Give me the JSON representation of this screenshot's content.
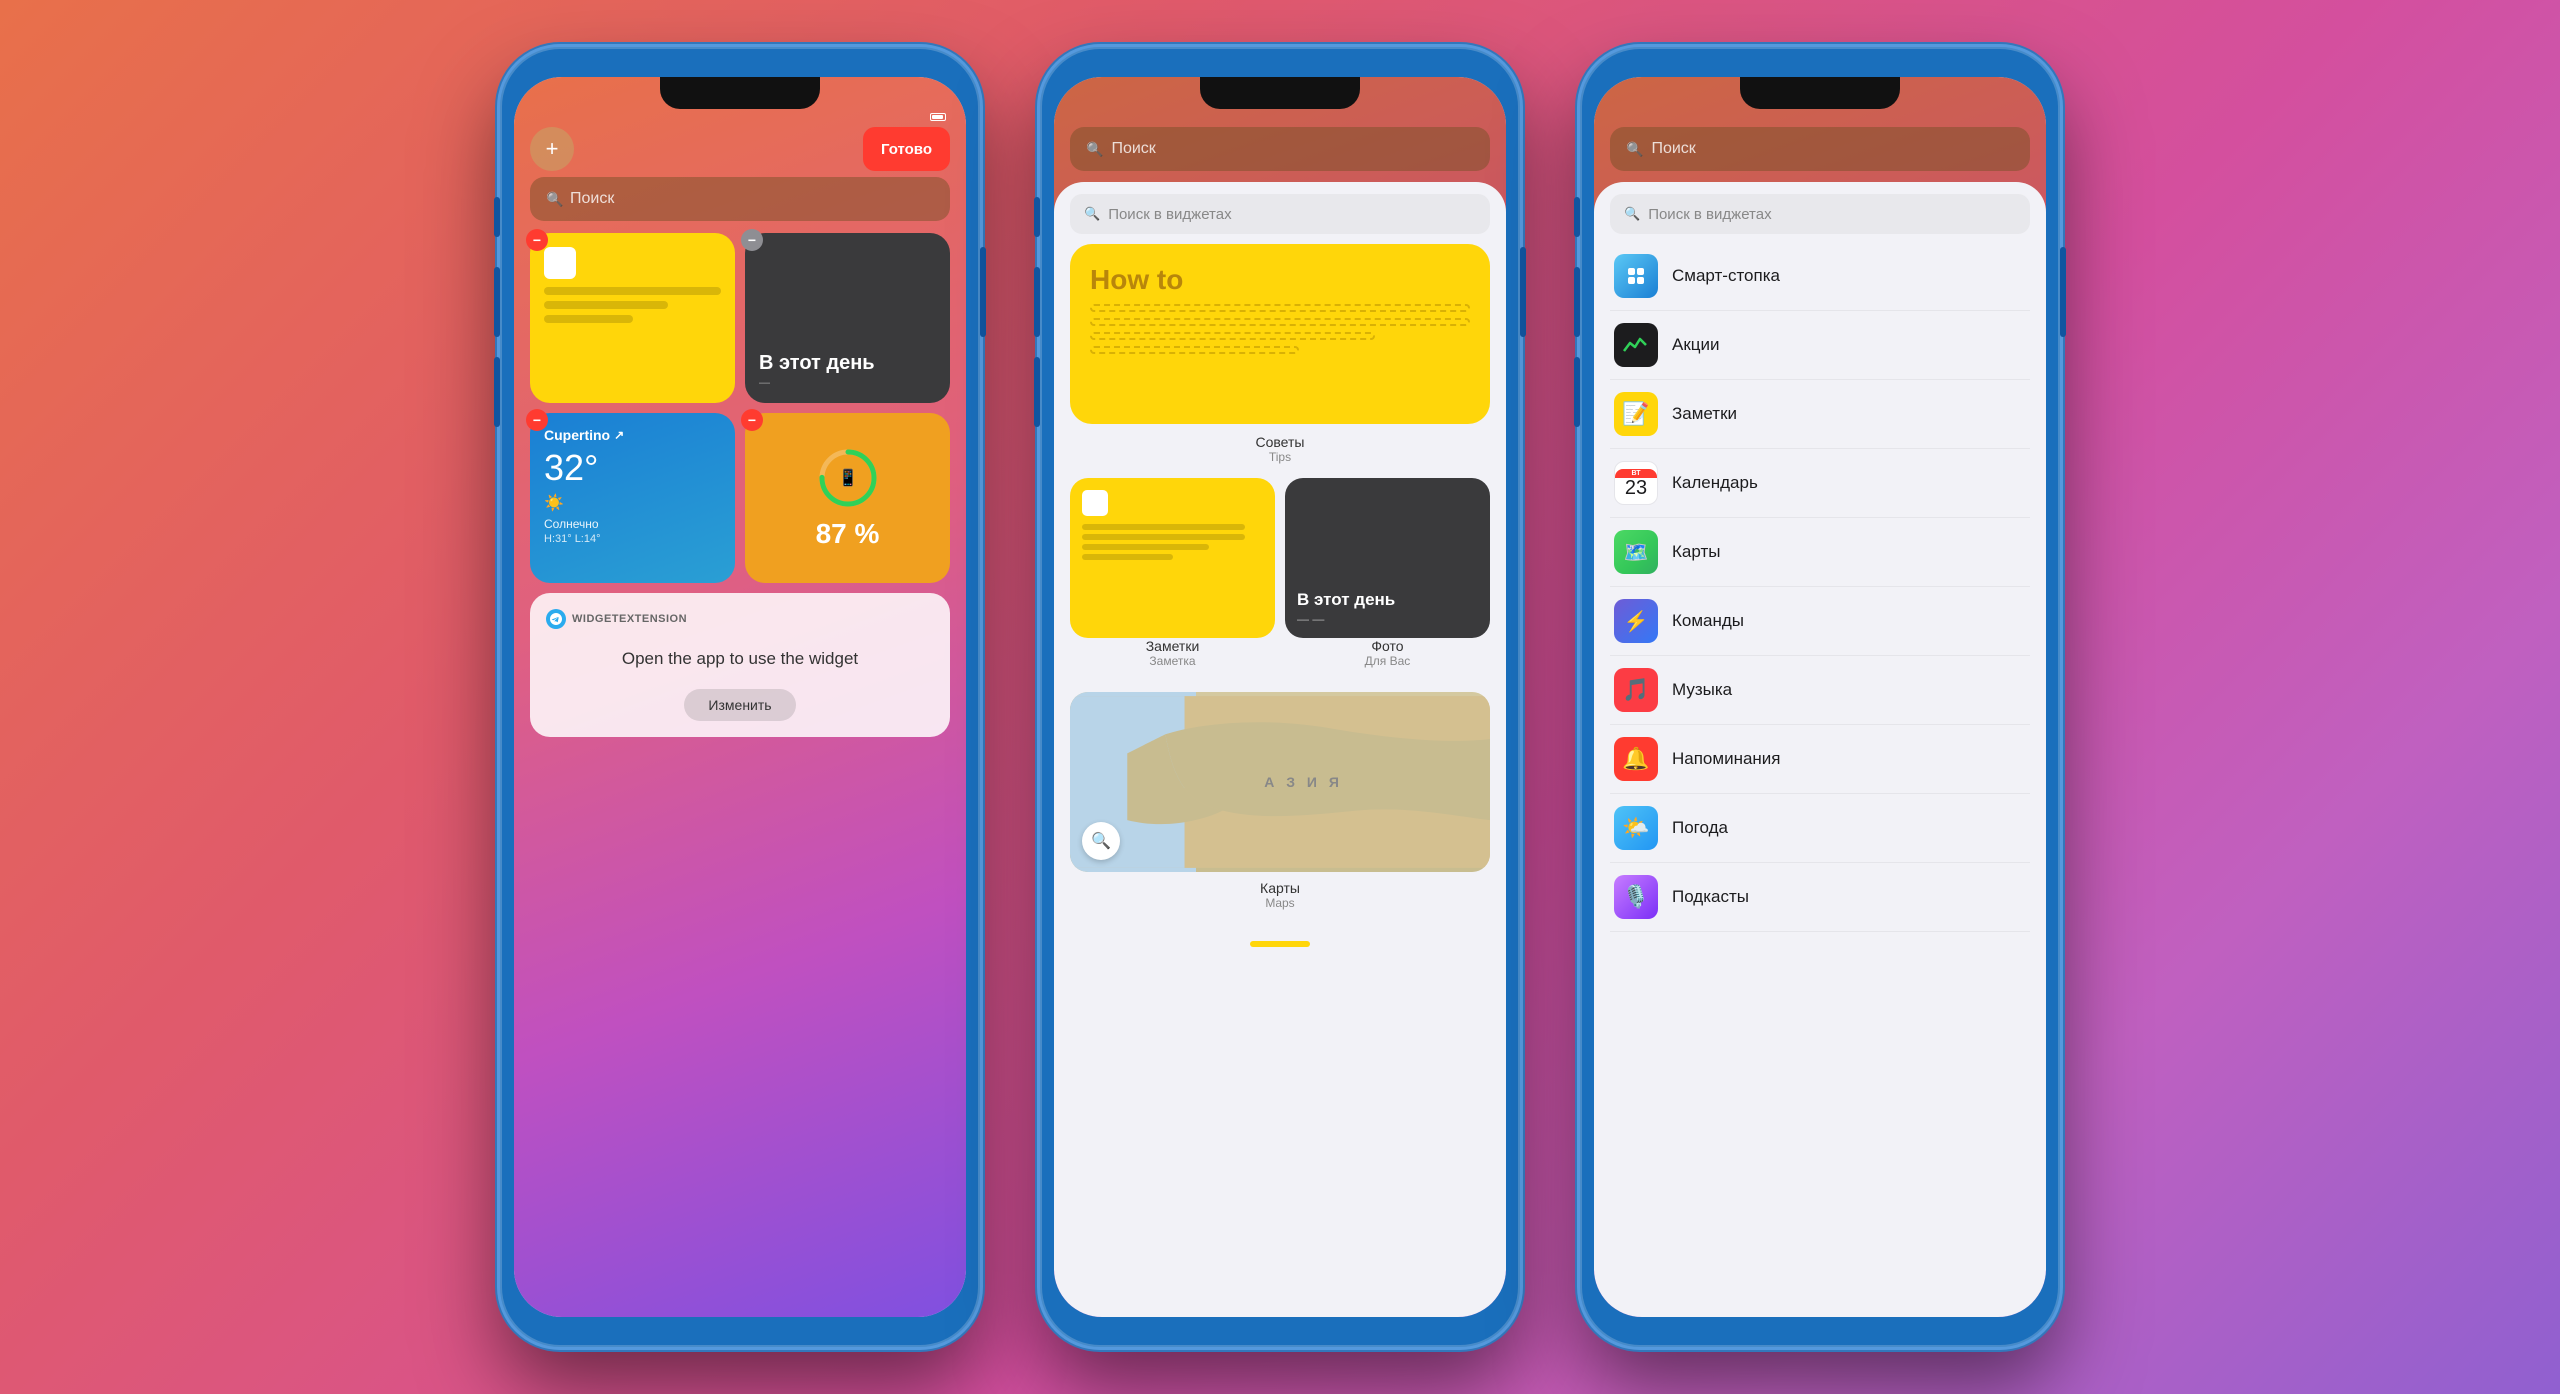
{
  "background": {
    "gradient": "linear-gradient(135deg, #e8704a 0%, #e05a6b 30%, #d44f9e 60%, #c060c0 80%, #9060d0 100%)"
  },
  "phone1": {
    "search_placeholder": "Поиск",
    "btn_add_label": "+",
    "btn_done_label": "Готово",
    "widget_notes_label": "",
    "widget_this_day_label": "В этот день",
    "widget_weather_city": "Cupertino",
    "widget_weather_temp": "32°",
    "widget_weather_desc": "Солнечно",
    "widget_weather_minmax": "H:31° L:14°",
    "widget_battery_pct": "87 %",
    "telegram_label": "WIDGETEXTENSION",
    "telegram_msg": "Open the app to use the widget",
    "btn_change_label": "Изменить"
  },
  "phone2": {
    "search_placeholder": "Поиск",
    "widget_search_placeholder": "Поиск в виджетах",
    "tips_widget": {
      "how_to": "How to",
      "name": "Советы",
      "subname": "Tips"
    },
    "notes_widget": {
      "name": "Заметки",
      "subname": "Заметка"
    },
    "photo_widget": {
      "label": "В этот день",
      "name": "Фото",
      "subname": "Для Вас"
    },
    "maps_widget": {
      "asia_label": "А З И Я",
      "name": "Карты",
      "subname": "Maps"
    }
  },
  "phone3": {
    "search_placeholder": "Поиск",
    "widget_search_placeholder": "Поиск в виджетах",
    "apps": [
      {
        "name": "Смарт-стопка",
        "icon_class": "icon-smartstack"
      },
      {
        "name": "Акции",
        "icon_class": "icon-stocks"
      },
      {
        "name": "Заметки",
        "icon_class": "icon-notes"
      },
      {
        "name": "Календарь",
        "icon_class": "icon-calendar"
      },
      {
        "name": "Карты",
        "icon_class": "icon-maps"
      },
      {
        "name": "Команды",
        "icon_class": "icon-shortcuts"
      },
      {
        "name": "Музыка",
        "icon_class": "icon-music"
      },
      {
        "name": "Напоминания",
        "icon_class": "icon-reminders"
      },
      {
        "name": "Погода",
        "icon_class": "icon-weather"
      },
      {
        "name": "Подкасты",
        "icon_class": "icon-podcasts"
      }
    ],
    "calendar_day": "23",
    "calendar_month": "Вторник"
  }
}
